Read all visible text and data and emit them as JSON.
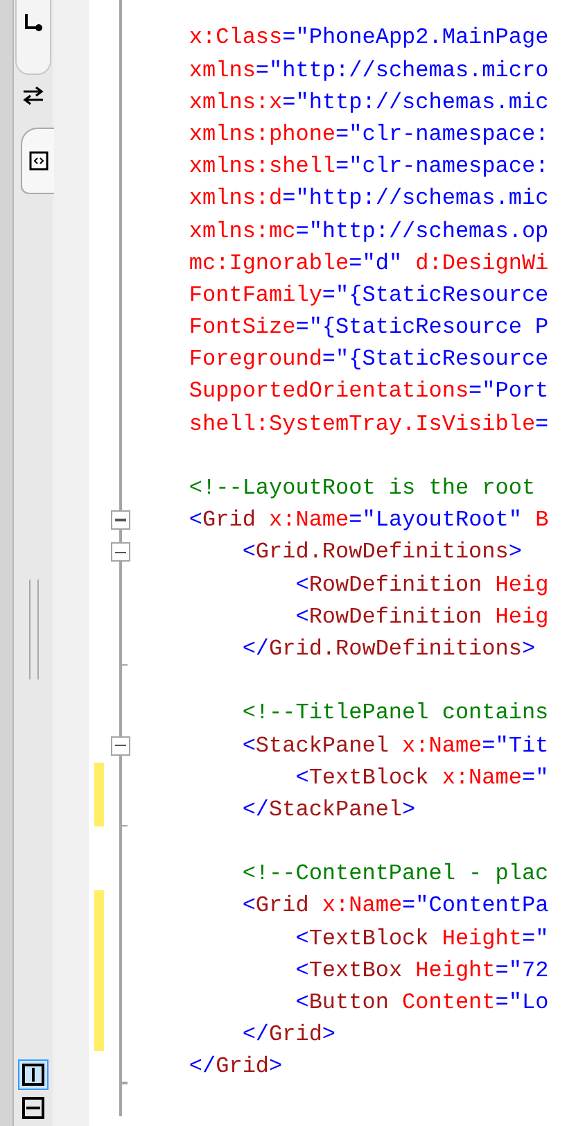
{
  "pane_tabs": [
    {
      "kind": "design",
      "selected": false
    },
    {
      "kind": "xaml",
      "selected": true
    }
  ],
  "view_buttons": [
    {
      "kind": "vertical",
      "selected": true
    },
    {
      "kind": "horizontal",
      "selected": false
    }
  ],
  "code_lines": [
    {
      "changed": false,
      "collapsible": false,
      "fold_end": false,
      "tokens": [
        {
          "kind": "attr",
          "text": "    x:Class"
        },
        {
          "kind": "punct",
          "text": "="
        },
        {
          "kind": "value",
          "text": "\"PhoneApp2.MainPage"
        }
      ]
    },
    {
      "changed": false,
      "collapsible": false,
      "fold_end": false,
      "tokens": [
        {
          "kind": "attr",
          "text": "    xmlns"
        },
        {
          "kind": "punct",
          "text": "="
        },
        {
          "kind": "value",
          "text": "\"http://schemas.micro"
        }
      ]
    },
    {
      "changed": false,
      "collapsible": false,
      "fold_end": false,
      "tokens": [
        {
          "kind": "attr",
          "text": "    xmlns:x"
        },
        {
          "kind": "punct",
          "text": "="
        },
        {
          "kind": "value",
          "text": "\"http://schemas.mic"
        }
      ]
    },
    {
      "changed": false,
      "collapsible": false,
      "fold_end": false,
      "tokens": [
        {
          "kind": "attr",
          "text": "    xmlns:phone"
        },
        {
          "kind": "punct",
          "text": "="
        },
        {
          "kind": "value",
          "text": "\"clr-namespace:"
        }
      ]
    },
    {
      "changed": false,
      "collapsible": false,
      "fold_end": false,
      "tokens": [
        {
          "kind": "attr",
          "text": "    xmlns:shell"
        },
        {
          "kind": "punct",
          "text": "="
        },
        {
          "kind": "value",
          "text": "\"clr-namespace:"
        }
      ]
    },
    {
      "changed": false,
      "collapsible": false,
      "fold_end": false,
      "tokens": [
        {
          "kind": "attr",
          "text": "    xmlns:d"
        },
        {
          "kind": "punct",
          "text": "="
        },
        {
          "kind": "value",
          "text": "\"http://schemas.mic"
        }
      ]
    },
    {
      "changed": false,
      "collapsible": false,
      "fold_end": false,
      "tokens": [
        {
          "kind": "attr",
          "text": "    xmlns:mc"
        },
        {
          "kind": "punct",
          "text": "="
        },
        {
          "kind": "value",
          "text": "\"http://schemas.op"
        }
      ]
    },
    {
      "changed": false,
      "collapsible": false,
      "fold_end": false,
      "tokens": [
        {
          "kind": "attr",
          "text": "    mc:Ignorable"
        },
        {
          "kind": "punct",
          "text": "="
        },
        {
          "kind": "value",
          "text": "\"d\" "
        },
        {
          "kind": "attr",
          "text": "d:DesignWi"
        }
      ]
    },
    {
      "changed": false,
      "collapsible": false,
      "fold_end": false,
      "tokens": [
        {
          "kind": "attr",
          "text": "    FontFamily"
        },
        {
          "kind": "punct",
          "text": "="
        },
        {
          "kind": "value",
          "text": "\"{StaticResource"
        }
      ]
    },
    {
      "changed": false,
      "collapsible": false,
      "fold_end": false,
      "tokens": [
        {
          "kind": "attr",
          "text": "    FontSize"
        },
        {
          "kind": "punct",
          "text": "="
        },
        {
          "kind": "value",
          "text": "\"{StaticResource P"
        }
      ]
    },
    {
      "changed": false,
      "collapsible": false,
      "fold_end": false,
      "tokens": [
        {
          "kind": "attr",
          "text": "    Foreground"
        },
        {
          "kind": "punct",
          "text": "="
        },
        {
          "kind": "value",
          "text": "\"{StaticResource"
        }
      ]
    },
    {
      "changed": false,
      "collapsible": false,
      "fold_end": false,
      "tokens": [
        {
          "kind": "attr",
          "text": "    SupportedOrientations"
        },
        {
          "kind": "punct",
          "text": "="
        },
        {
          "kind": "value",
          "text": "\"Port"
        }
      ]
    },
    {
      "changed": false,
      "collapsible": false,
      "fold_end": false,
      "tokens": [
        {
          "kind": "attr",
          "text": "    shell:SystemTray.IsVisible"
        },
        {
          "kind": "punct",
          "text": "="
        }
      ]
    },
    {
      "changed": false,
      "collapsible": false,
      "fold_end": false
    },
    {
      "changed": false,
      "collapsible": false,
      "fold_end": false,
      "tokens": [
        {
          "kind": "comment",
          "text": "    <!--LayoutRoot is the root"
        }
      ]
    },
    {
      "changed": false,
      "collapsible": true,
      "fold_end": false,
      "tokens": [
        {
          "kind": "punct",
          "text": "    <"
        },
        {
          "kind": "tag",
          "text": "Grid"
        },
        {
          "kind": "attr",
          "text": " x:Name"
        },
        {
          "kind": "punct",
          "text": "="
        },
        {
          "kind": "value",
          "text": "\"LayoutRoot\" "
        },
        {
          "kind": "attr",
          "text": "B"
        }
      ]
    },
    {
      "changed": false,
      "collapsible": true,
      "fold_end": false,
      "tokens": [
        {
          "kind": "punct",
          "text": "        <"
        },
        {
          "kind": "tag",
          "text": "Grid.RowDefinitions"
        },
        {
          "kind": "punct",
          "text": ">"
        }
      ]
    },
    {
      "changed": false,
      "collapsible": false,
      "fold_end": false,
      "tokens": [
        {
          "kind": "punct",
          "text": "            <"
        },
        {
          "kind": "tag",
          "text": "RowDefinition"
        },
        {
          "kind": "attr",
          "text": " Heig"
        }
      ]
    },
    {
      "changed": false,
      "collapsible": false,
      "fold_end": false,
      "tokens": [
        {
          "kind": "punct",
          "text": "            <"
        },
        {
          "kind": "tag",
          "text": "RowDefinition"
        },
        {
          "kind": "attr",
          "text": " Heig"
        }
      ]
    },
    {
      "changed": false,
      "collapsible": false,
      "fold_end": true,
      "tokens": [
        {
          "kind": "punct",
          "text": "        </"
        },
        {
          "kind": "tag",
          "text": "Grid.RowDefinitions"
        },
        {
          "kind": "punct",
          "text": ">"
        }
      ]
    },
    {
      "changed": false,
      "collapsible": false,
      "fold_end": false
    },
    {
      "changed": false,
      "collapsible": false,
      "fold_end": false,
      "tokens": [
        {
          "kind": "comment",
          "text": "        <!--TitlePanel contains"
        }
      ]
    },
    {
      "changed": false,
      "collapsible": true,
      "fold_end": false,
      "tokens": [
        {
          "kind": "punct",
          "text": "        <"
        },
        {
          "kind": "tag",
          "text": "StackPanel"
        },
        {
          "kind": "attr",
          "text": " x:Name"
        },
        {
          "kind": "punct",
          "text": "="
        },
        {
          "kind": "value",
          "text": "\"Tit"
        }
      ]
    },
    {
      "changed": true,
      "collapsible": false,
      "fold_end": false,
      "tokens": [
        {
          "kind": "punct",
          "text": "            <"
        },
        {
          "kind": "tag",
          "text": "TextBlock"
        },
        {
          "kind": "attr",
          "text": " x:Name"
        },
        {
          "kind": "punct",
          "text": "="
        },
        {
          "kind": "value",
          "text": "\""
        }
      ]
    },
    {
      "changed": true,
      "collapsible": false,
      "fold_end": true,
      "tokens": [
        {
          "kind": "punct",
          "text": "        </"
        },
        {
          "kind": "tag",
          "text": "StackPanel"
        },
        {
          "kind": "punct",
          "text": ">"
        }
      ]
    },
    {
      "changed": false,
      "collapsible": false,
      "fold_end": false
    },
    {
      "changed": false,
      "collapsible": false,
      "fold_end": false,
      "tokens": [
        {
          "kind": "comment",
          "text": "        <!--ContentPanel - plac"
        }
      ]
    },
    {
      "changed": true,
      "collapsible": false,
      "fold_end": false,
      "tokens": [
        {
          "kind": "punct",
          "text": "        <"
        },
        {
          "kind": "tag",
          "text": "Grid"
        },
        {
          "kind": "attr",
          "text": " x:Name"
        },
        {
          "kind": "punct",
          "text": "="
        },
        {
          "kind": "value",
          "text": "\"ContentPa"
        }
      ]
    },
    {
      "changed": true,
      "collapsible": false,
      "fold_end": false,
      "tokens": [
        {
          "kind": "punct",
          "text": "            <"
        },
        {
          "kind": "tag",
          "text": "TextBlock"
        },
        {
          "kind": "attr",
          "text": " Height"
        },
        {
          "kind": "punct",
          "text": "="
        },
        {
          "kind": "value",
          "text": "\""
        }
      ]
    },
    {
      "changed": true,
      "collapsible": false,
      "fold_end": false,
      "tokens": [
        {
          "kind": "punct",
          "text": "            <"
        },
        {
          "kind": "tag",
          "text": "TextBox"
        },
        {
          "kind": "attr",
          "text": " Height"
        },
        {
          "kind": "punct",
          "text": "="
        },
        {
          "kind": "value",
          "text": "\"72"
        }
      ]
    },
    {
      "changed": true,
      "collapsible": false,
      "fold_end": false,
      "tokens": [
        {
          "kind": "punct",
          "text": "            <"
        },
        {
          "kind": "tag",
          "text": "Button"
        },
        {
          "kind": "attr",
          "text": " Content"
        },
        {
          "kind": "punct",
          "text": "="
        },
        {
          "kind": "value",
          "text": "\"Lo"
        }
      ]
    },
    {
      "changed": true,
      "collapsible": false,
      "fold_end": false,
      "tokens": [
        {
          "kind": "punct",
          "text": "        </"
        },
        {
          "kind": "tag",
          "text": "Grid"
        },
        {
          "kind": "punct",
          "text": ">"
        }
      ]
    },
    {
      "changed": false,
      "collapsible": false,
      "fold_end": true,
      "tokens": [
        {
          "kind": "punct",
          "text": "    </"
        },
        {
          "kind": "tag",
          "text": "Grid"
        },
        {
          "kind": "punct",
          "text": ">"
        }
      ]
    },
    {
      "changed": false,
      "collapsible": false,
      "fold_end": false
    }
  ]
}
